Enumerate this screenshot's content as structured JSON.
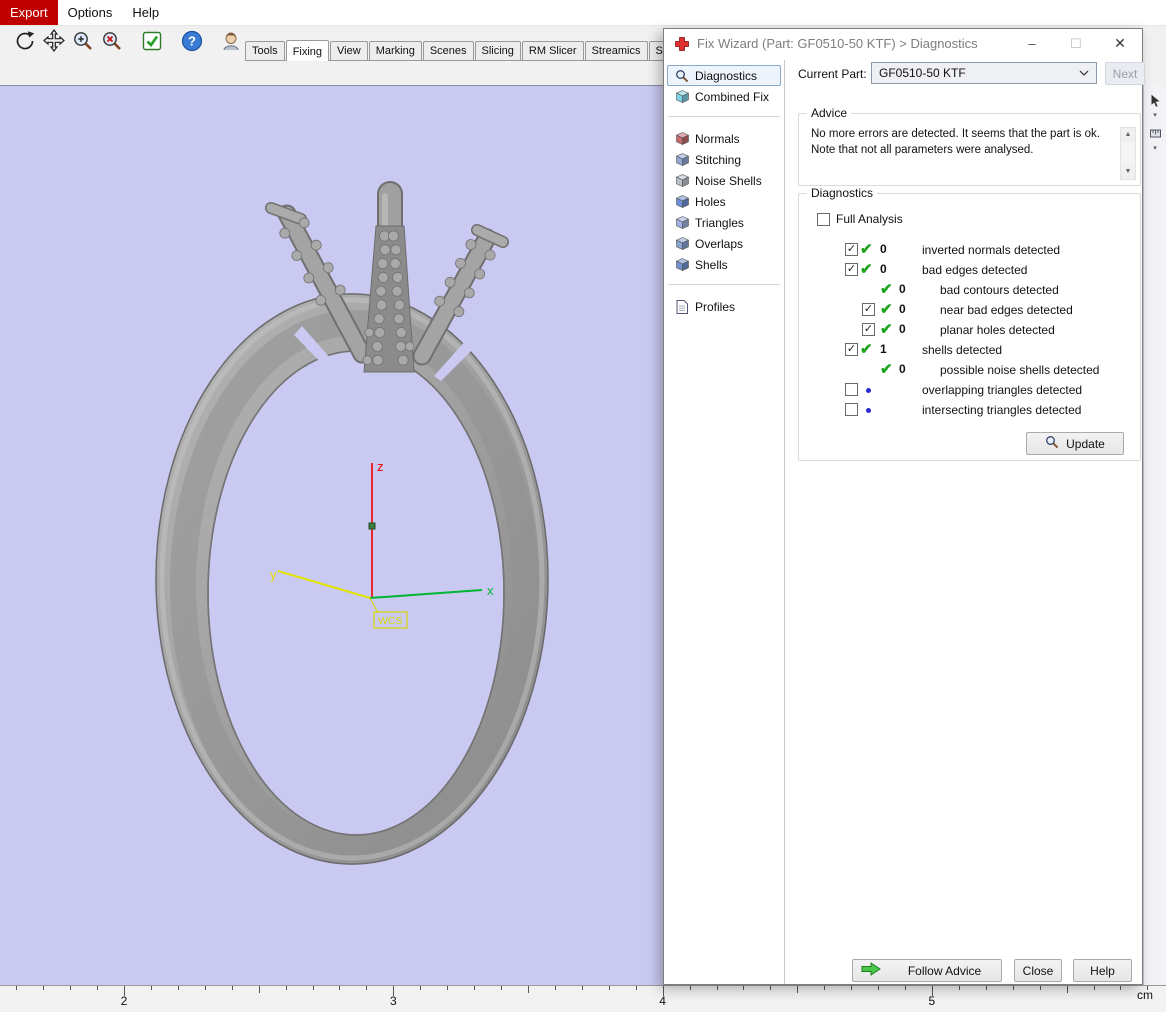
{
  "colors": {
    "viewport_bg": "#c9c9f1",
    "accent_green": "#1fa31f",
    "accent_blue_dot": "#2a2ad4",
    "axis_x": "#00b532",
    "axis_y": "#e2e200",
    "axis_z": "#ee0000",
    "wcs_yellow": "#d8d800",
    "menu_highlight": "#bf0000"
  },
  "menubar": {
    "items": [
      {
        "label": "Export",
        "highlighted": true
      },
      {
        "label": "Options",
        "highlighted": false
      },
      {
        "label": "Help",
        "highlighted": false
      }
    ]
  },
  "toolbar": {
    "icons": [
      {
        "name": "rotate-icon"
      },
      {
        "name": "pan-icon"
      },
      {
        "name": "zoom-in-icon"
      },
      {
        "name": "zoom-remove-icon"
      },
      {
        "name": "fix-check-icon"
      },
      {
        "name": "help-icon"
      },
      {
        "name": "part-search-icon"
      }
    ]
  },
  "tabs": {
    "active": "Fixing",
    "items": [
      "Tools",
      "Fixing",
      "View",
      "Marking",
      "Scenes",
      "Slicing",
      "RM Slicer",
      "Streamics",
      "Support Generation"
    ]
  },
  "right_toolbar": {
    "icons": [
      {
        "name": "cursor-tool-icon"
      },
      {
        "name": "measure-tool-icon"
      }
    ]
  },
  "viewport": {
    "wcs_label": "WCS",
    "axis_labels": {
      "x": "x",
      "y": "y",
      "z": "z"
    }
  },
  "ruler": {
    "labels": [
      "2",
      "3",
      "4",
      "5"
    ],
    "unit": "cm"
  },
  "dialog": {
    "title": "Fix Wizard (Part: GF0510-50 KTF) > Diagnostics",
    "window_buttons": [
      "minimize",
      "maximize",
      "close"
    ],
    "current_part": {
      "label": "Current Part:",
      "value": "GF0510-50 KTF",
      "next_label": "Next"
    },
    "sidebar": {
      "groups": [
        {
          "items": [
            {
              "label": "Diagnostics",
              "icon": "magnifier-icon",
              "selected": true
            },
            {
              "label": "Combined Fix",
              "icon": "cube-icon",
              "color": "#7fd4ea",
              "selected": false
            }
          ]
        },
        {
          "items": [
            {
              "label": "Normals",
              "icon": "cube-icon",
              "color": "#c46a6a",
              "selected": false
            },
            {
              "label": "Stitching",
              "icon": "cube-icon",
              "color": "#8fa8d8",
              "selected": false
            },
            {
              "label": "Noise Shells",
              "icon": "cube-icon",
              "color": "#b9c2cc",
              "selected": false
            },
            {
              "label": "Holes",
              "icon": "cube-icon",
              "color": "#6f8fd8",
              "selected": false
            },
            {
              "label": "Triangles",
              "icon": "cube-icon",
              "color": "#9fb4e0",
              "selected": false
            },
            {
              "label": "Overlaps",
              "icon": "cube-icon",
              "color": "#8aa4d4",
              "selected": false
            },
            {
              "label": "Shells",
              "icon": "cube-icon",
              "color": "#7593d0",
              "selected": false
            }
          ]
        },
        {
          "items": [
            {
              "label": "Profiles",
              "icon": "document-icon",
              "selected": false
            }
          ]
        }
      ]
    },
    "advice": {
      "legend": "Advice",
      "lines": [
        "No more errors are detected. It seems that the part is ok.",
        "Note that not all parameters were analysed."
      ]
    },
    "diagnostics": {
      "legend": "Diagnostics",
      "full_analysis_label": "Full Analysis",
      "rows": [
        {
          "level": 0,
          "checkbox": true,
          "checked": true,
          "status": "ok",
          "count": "0",
          "label": "inverted normals detected"
        },
        {
          "level": 0,
          "checkbox": true,
          "checked": true,
          "status": "ok",
          "count": "0",
          "label": "bad edges detected"
        },
        {
          "level": 1,
          "checkbox": false,
          "checked": false,
          "status": "ok",
          "count": "0",
          "label": "bad contours detected"
        },
        {
          "level": 1,
          "checkbox": true,
          "checked": true,
          "status": "ok",
          "count": "0",
          "label": "near bad edges detected"
        },
        {
          "level": 1,
          "checkbox": true,
          "checked": true,
          "status": "ok",
          "count": "0",
          "label": "planar holes detected"
        },
        {
          "level": 0,
          "checkbox": true,
          "checked": true,
          "status": "ok",
          "count": "1",
          "label": "shells detected"
        },
        {
          "level": 1,
          "checkbox": false,
          "checked": false,
          "status": "ok",
          "count": "0",
          "label": "possible noise shells detected"
        },
        {
          "level": 0,
          "checkbox": true,
          "checked": false,
          "status": "dot",
          "count": "",
          "label": "overlapping triangles detected"
        },
        {
          "level": 0,
          "checkbox": true,
          "checked": false,
          "status": "dot",
          "count": "",
          "label": "intersecting triangles detected"
        }
      ],
      "update_label": "Update"
    },
    "footer": {
      "follow_advice_label": "Follow Advice",
      "close_label": "Close",
      "help_label": "Help"
    }
  }
}
